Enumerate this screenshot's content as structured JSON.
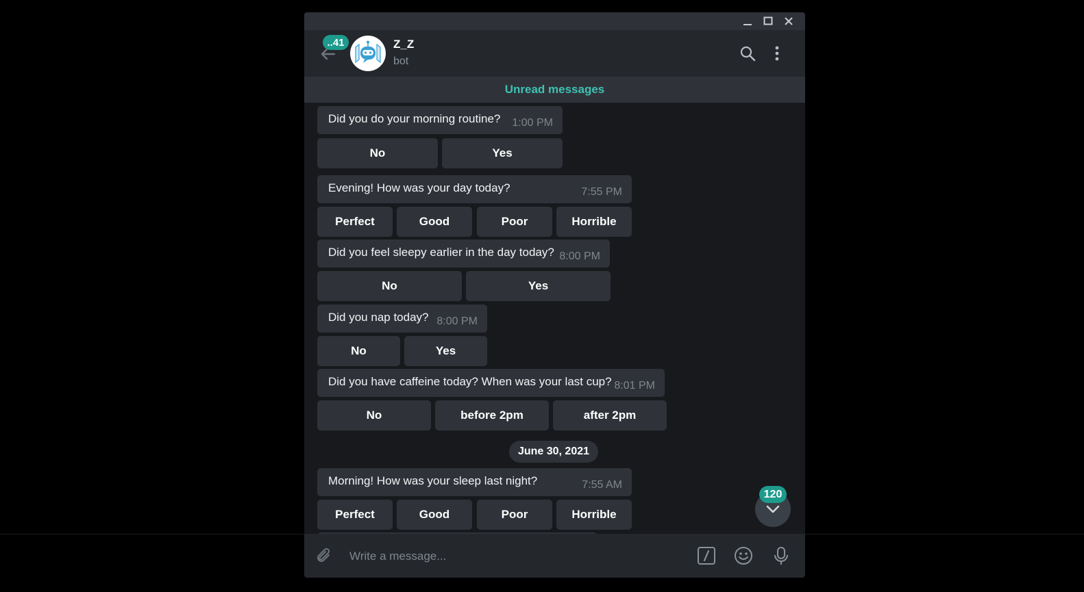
{
  "window": {
    "controls": {
      "minimize": "minimize",
      "maximize": "maximize",
      "close": "close"
    }
  },
  "header": {
    "unread_count": "..41",
    "chat_name": "Z_Z",
    "chat_status": "bot",
    "icons": [
      "back-arrow-icon",
      "search-icon",
      "more-vertical-icon"
    ]
  },
  "unread_bar": "Unread messages",
  "messages": [
    {
      "text": "Did you do your morning routine?",
      "time": "1:00 PM",
      "buttons": [
        "No",
        "Yes"
      ]
    },
    {
      "text": "Evening! How was your day today?",
      "time": "7:55 PM",
      "buttons": [
        "Perfect",
        "Good",
        "Poor",
        "Horrible"
      ]
    },
    {
      "text": "Did you feel sleepy earlier in the day today?",
      "time": "8:00 PM",
      "buttons": [
        "No",
        "Yes"
      ]
    },
    {
      "text": "Did you nap today?",
      "time": "8:00 PM",
      "buttons": [
        "No",
        "Yes"
      ]
    },
    {
      "text": "Did you have caffeine today? When was your last cup?",
      "time": "8:01 PM",
      "buttons": [
        "No",
        "before 2pm",
        "after 2pm"
      ]
    },
    {
      "text": "Morning! How was your sleep last night?",
      "time": "7:55 AM",
      "buttons": [
        "Perfect",
        "Good",
        "Poor",
        "Horrible"
      ]
    }
  ],
  "date_separator": "June 30, 2021",
  "scroll_down_badge": "120",
  "composer": {
    "placeholder": "Write a message...",
    "icons": [
      "attach-icon",
      "bot-command-icon",
      "emoji-icon",
      "microphone-icon"
    ]
  },
  "colors": {
    "accent": "#1d9b8c",
    "unread_text": "#3fc1b3",
    "bubble": "#2f3339",
    "header": "#24272c"
  }
}
